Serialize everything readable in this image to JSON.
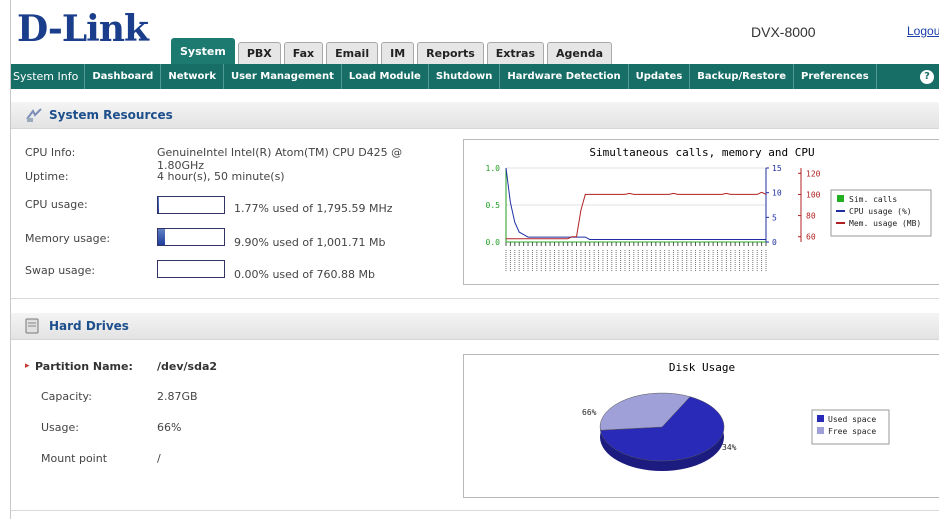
{
  "header": {
    "brand": "D-Link",
    "model": "DVX-8000",
    "logout": "Logout",
    "tabs": [
      "System",
      "PBX",
      "Fax",
      "Email",
      "IM",
      "Reports",
      "Extras",
      "Agenda"
    ],
    "active_tab": "System"
  },
  "nav": {
    "items": [
      "System Info",
      "Dashboard",
      "Network",
      "User Management",
      "Load Module",
      "Shutdown",
      "Hardware Detection",
      "Updates",
      "Backup/Restore",
      "Preferences"
    ],
    "help_icon": "?"
  },
  "system_resources": {
    "title": "System Resources",
    "cpu_info_label": "CPU Info:",
    "cpu_info_value": "GenuineIntel Intel(R) Atom(TM) CPU D425 @ 1.80GHz",
    "uptime_label": "Uptime:",
    "uptime_value": "4 hour(s), 50 minute(s)",
    "cpu_usage_label": "CPU usage:",
    "cpu_usage_text": "1.77% used of 1,795.59 MHz",
    "cpu_usage_pct": 1.77,
    "memory_usage_label": "Memory usage:",
    "memory_usage_text": "9.90% used of 1,001.71 Mb",
    "memory_usage_pct": 9.9,
    "swap_usage_label": "Swap usage:",
    "swap_usage_text": "0.00% used of 760.88 Mb",
    "swap_usage_pct": 0
  },
  "hard_drives": {
    "title": "Hard Drives",
    "partition_label": "Partition Name:",
    "partition_value": "/dev/sda2",
    "capacity_label": "Capacity:",
    "capacity_value": "2.87GB",
    "usage_label": "Usage:",
    "usage_value": "66%",
    "mount_label": "Mount point",
    "mount_value": "/"
  },
  "chart_data": [
    {
      "type": "line",
      "title": "Simultaneous calls, memory and CPU",
      "left_axis": {
        "ticks": [
          "0.0",
          "0.5",
          "1.0"
        ],
        "range": [
          0,
          1
        ],
        "color": "#1f9e1f"
      },
      "mid_axis": {
        "ticks": [
          "0",
          "5",
          "10",
          "15"
        ],
        "range": [
          0,
          15
        ],
        "color": "#1f2fa3"
      },
      "right_axis": {
        "ticks": [
          "60",
          "80",
          "100",
          "120"
        ],
        "range": [
          55,
          125
        ],
        "color": "#b02020"
      },
      "series": [
        {
          "name": "Sim. calls",
          "color": "#22b022",
          "values": [
            0,
            0,
            0,
            0,
            0,
            0,
            0,
            0,
            0,
            0,
            0,
            0,
            0,
            0,
            0,
            0,
            0,
            0,
            0,
            0,
            0,
            0,
            0,
            0,
            0,
            0,
            0,
            0,
            0,
            0,
            0,
            0,
            0,
            0,
            0,
            0,
            0,
            0,
            0,
            0,
            0,
            0,
            0,
            0,
            0,
            0,
            0,
            0,
            0,
            0,
            0,
            0,
            0,
            0,
            0,
            0,
            0,
            0,
            0,
            0
          ]
        },
        {
          "name": "CPU usage (%)",
          "color": "#1f2fa3",
          "values": [
            15,
            8,
            4,
            2,
            1.5,
            1,
            1,
            1,
            1,
            1,
            1,
            1,
            1,
            1,
            1,
            1,
            1,
            1,
            1,
            0.5,
            0.5,
            0.5,
            0.5,
            0.5,
            0.5,
            0.5,
            0.5,
            0.5,
            0.5,
            0.5,
            0.5,
            0.5,
            0.5,
            0.5,
            0.5,
            0.5,
            0.5,
            0.5,
            0.5,
            0.5,
            0.5,
            0.5,
            0.5,
            0.5,
            0.5,
            0.5,
            0.5,
            0.5,
            0.5,
            0.5,
            0.5,
            0.5,
            0.5,
            0.5,
            0.5,
            0.5,
            0.5,
            0.5,
            0.5,
            0.5
          ]
        },
        {
          "name": "Mem. usage (MB)",
          "color": "#b02020",
          "values": [
            58,
            58,
            58,
            58,
            58,
            58,
            58,
            58,
            58,
            58,
            58,
            58,
            58,
            58,
            58,
            60,
            60,
            85,
            100,
            100,
            100,
            100,
            100,
            100,
            100,
            100,
            100,
            100,
            101,
            100,
            100,
            100,
            100,
            100,
            100,
            100,
            100,
            100,
            101,
            100,
            100,
            100,
            100,
            100,
            100,
            100,
            100,
            100,
            100,
            100,
            101,
            100,
            100,
            100,
            100,
            100,
            100,
            100,
            102,
            100
          ]
        }
      ]
    },
    {
      "type": "pie",
      "title": "Disk Usage",
      "labels": [
        "Used space",
        "Free space"
      ],
      "values": [
        66,
        34
      ],
      "value_labels": [
        "66%",
        "34%"
      ],
      "colors": [
        "#2a2ab8",
        "#a0a0d8"
      ]
    }
  ]
}
